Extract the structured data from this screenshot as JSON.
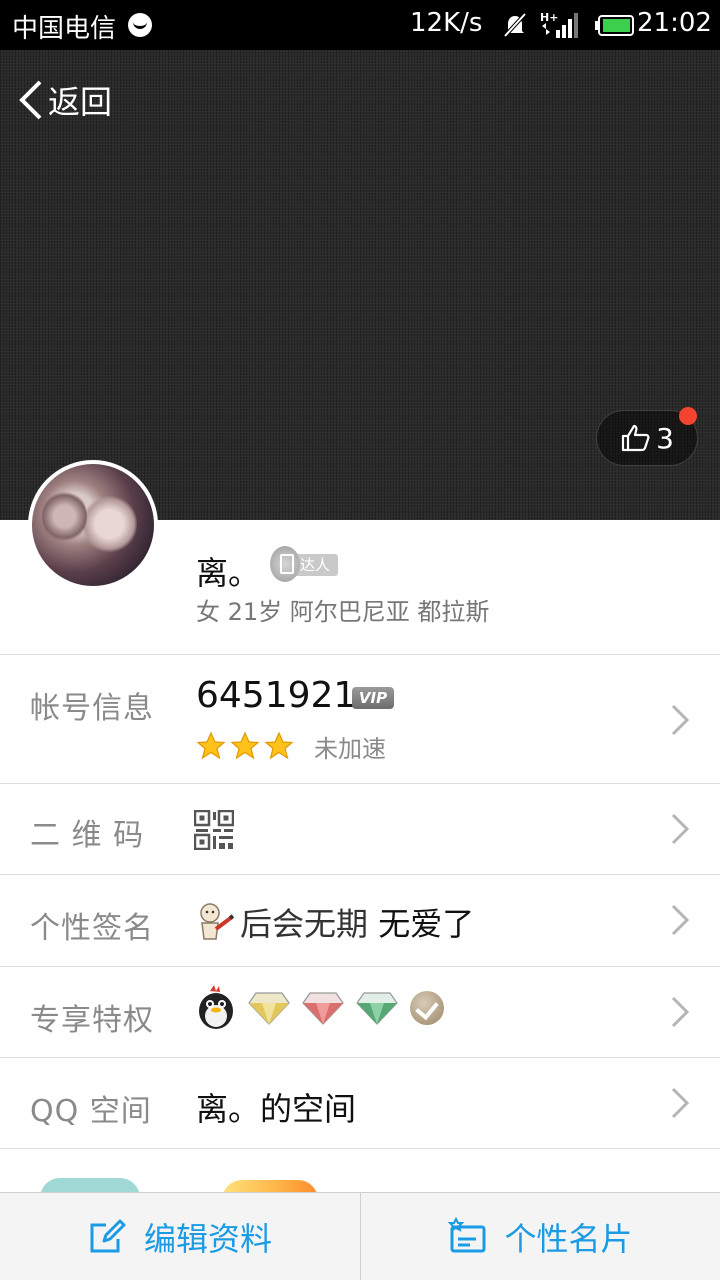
{
  "status_bar": {
    "carrier": "中国电信",
    "speed": "12K/s",
    "time": "21:02"
  },
  "header": {
    "back_label": "返回",
    "like_count": "3"
  },
  "profile": {
    "name": "离。",
    "badge_text": "达人",
    "meta": "女 21岁 阿尔巴尼亚 都拉斯"
  },
  "rows": {
    "account": {
      "label": "帐号信息",
      "number": "6451921",
      "vip_badge": "VIP",
      "stars": 3,
      "accel_status": "未加速"
    },
    "qrcode": {
      "label": "二 维 码"
    },
    "signature": {
      "label": "个性签名",
      "text_part1": "后会无期 ",
      "text_part2": "无爱了"
    },
    "privileges": {
      "label": "专享特权",
      "icons": [
        "penguin-icon",
        "gold-diamond-icon",
        "red-diamond-icon",
        "green-diamond-icon",
        "coin-check-icon"
      ]
    },
    "qzone": {
      "label": "QQ 空间",
      "value": "离。的空间"
    }
  },
  "bottom_bar": {
    "edit_label": "编辑资料",
    "card_label": "个性名片"
  },
  "colors": {
    "accent": "#1a9be3",
    "notification_dot": "#f4432e",
    "label_gray": "#8a8a8a"
  }
}
